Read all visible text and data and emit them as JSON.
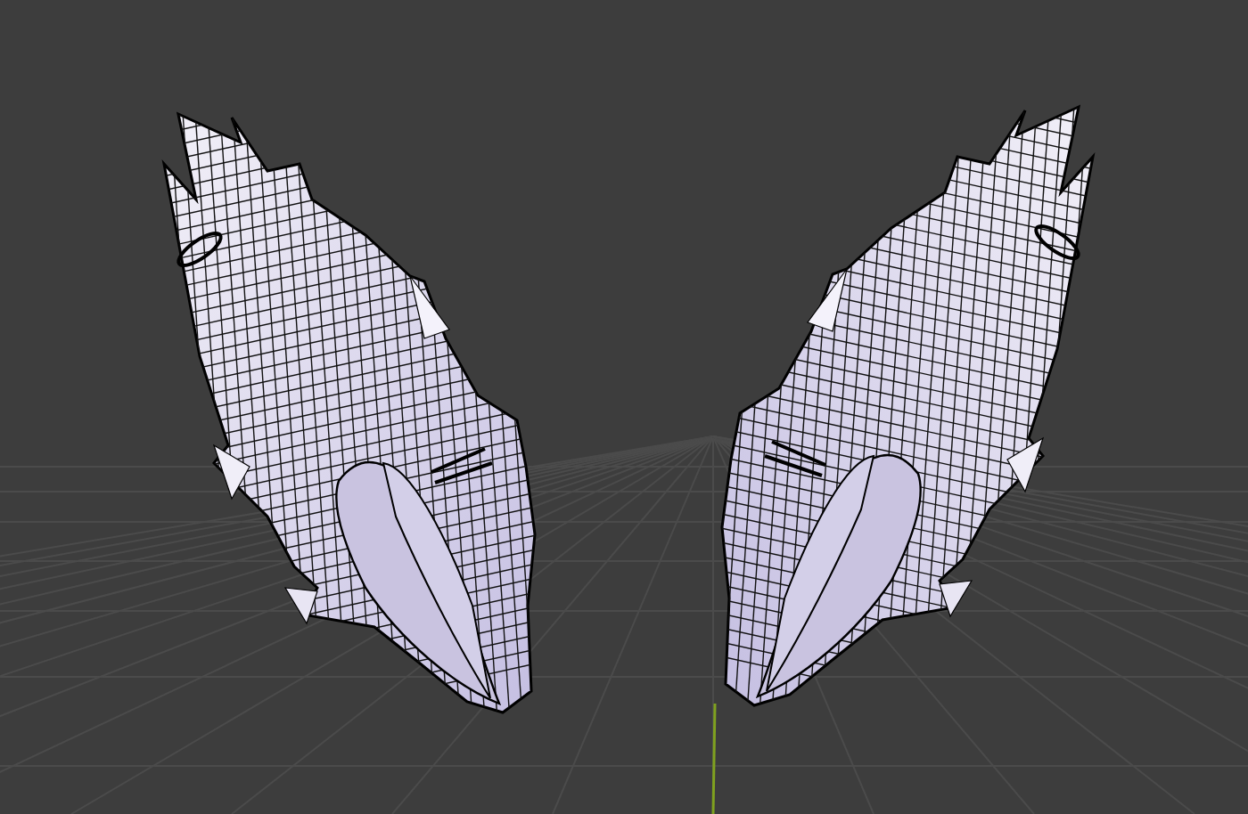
{
  "viewport": {
    "grid": true,
    "axis_line": true,
    "objects": [
      {
        "kind": "wing-mesh",
        "mirrored": false
      },
      {
        "kind": "wing-mesh",
        "mirrored": true
      }
    ]
  }
}
